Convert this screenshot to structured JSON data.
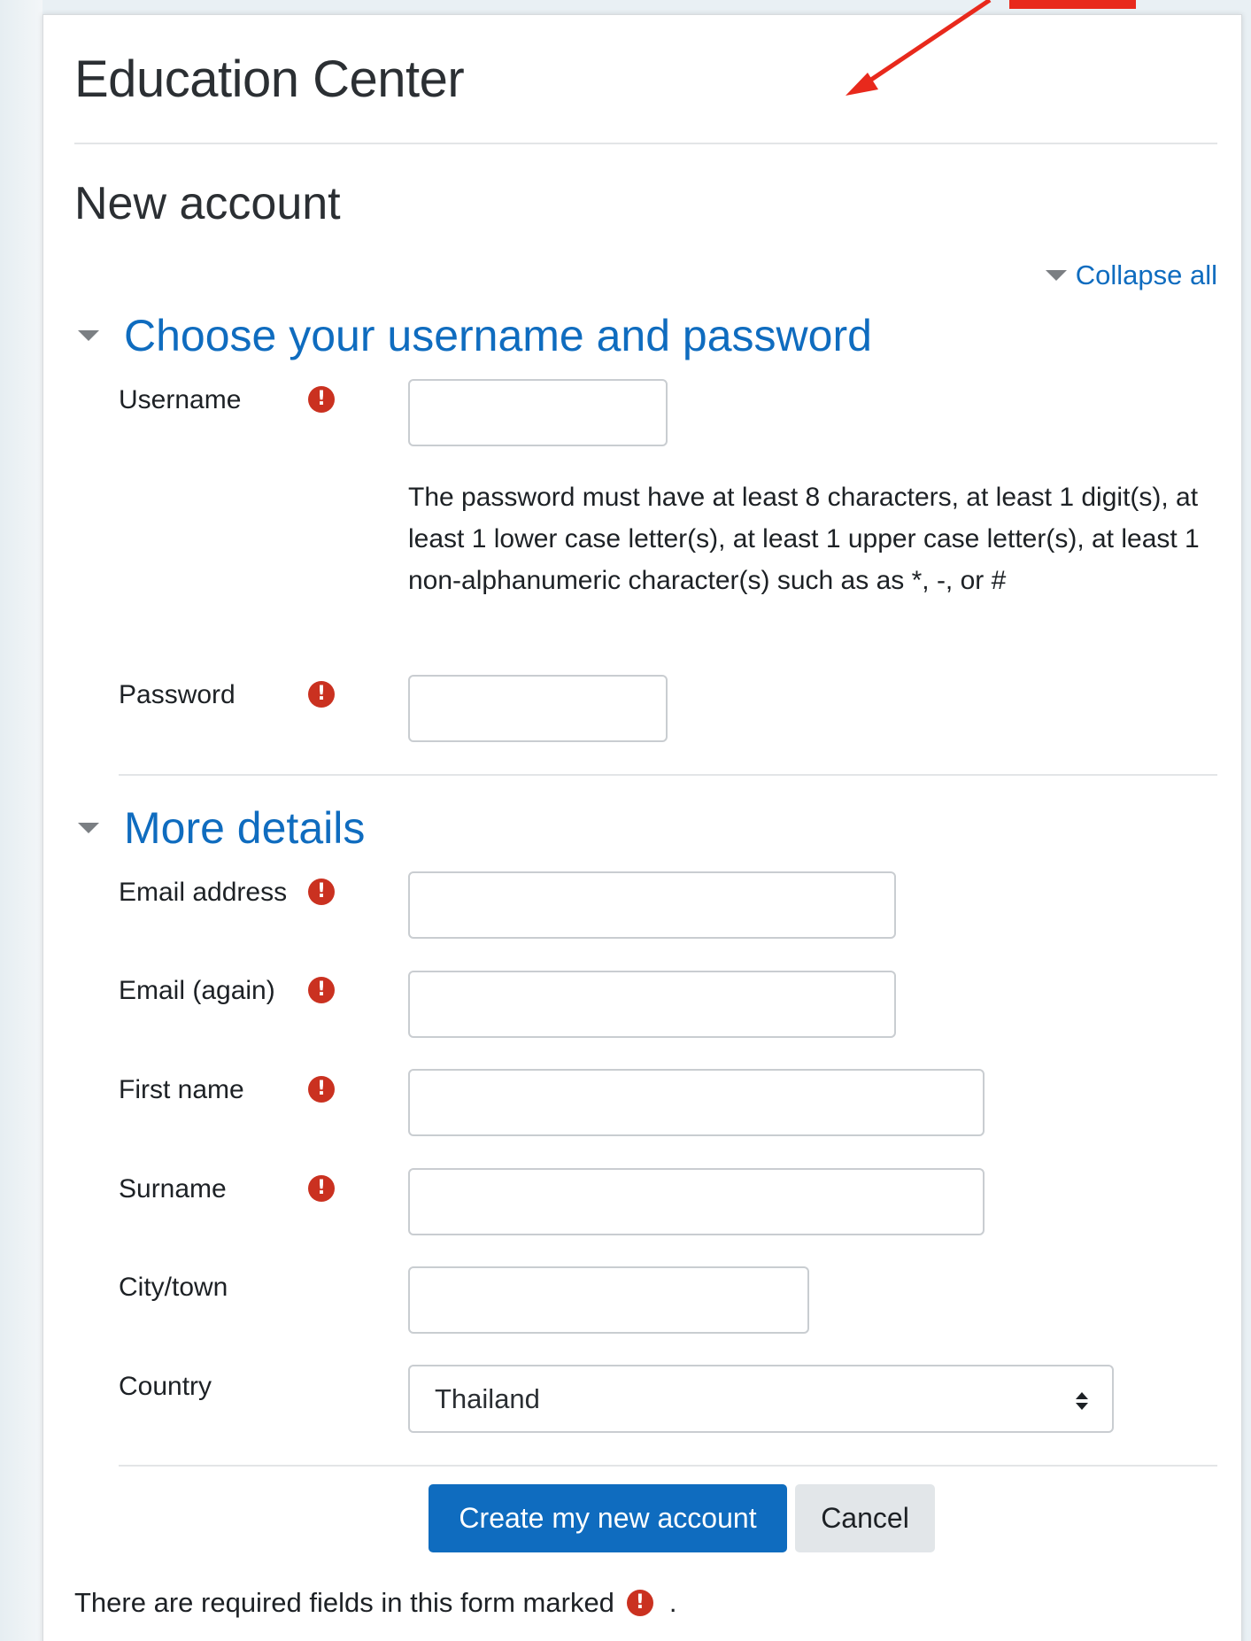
{
  "site": {
    "title": "Education Center"
  },
  "page": {
    "heading": "New account"
  },
  "collapse_all_label": "Collapse all",
  "sections": [
    {
      "title": "Choose your username and password"
    },
    {
      "title": "More details"
    }
  ],
  "fields": {
    "username": {
      "label": "Username",
      "value": ""
    },
    "password_help": "The password must have at least 8 characters, at least 1 digit(s), at least 1 lower case letter(s), at least 1 upper case letter(s), at least 1 non-alphanumeric character(s) such as as *, -, or #",
    "password": {
      "label": "Password",
      "value": ""
    },
    "email": {
      "label": "Email address",
      "value": ""
    },
    "email_again": {
      "label": "Email (again)",
      "value": ""
    },
    "first_name": {
      "label": "First name",
      "value": ""
    },
    "surname": {
      "label": "Surname",
      "value": ""
    },
    "city": {
      "label": "City/town",
      "value": ""
    },
    "country": {
      "label": "Country",
      "selected": "Thailand"
    }
  },
  "required_icon": "exclamation-circle-icon",
  "buttons": {
    "submit": "Create my new account",
    "cancel": "Cancel"
  },
  "footer": {
    "required_note_before": "There are required fields in this form marked",
    "required_note_after": "."
  },
  "colors": {
    "accent": "#0f6cbf",
    "required": "#ca3120",
    "annotation": "#e8291c"
  }
}
